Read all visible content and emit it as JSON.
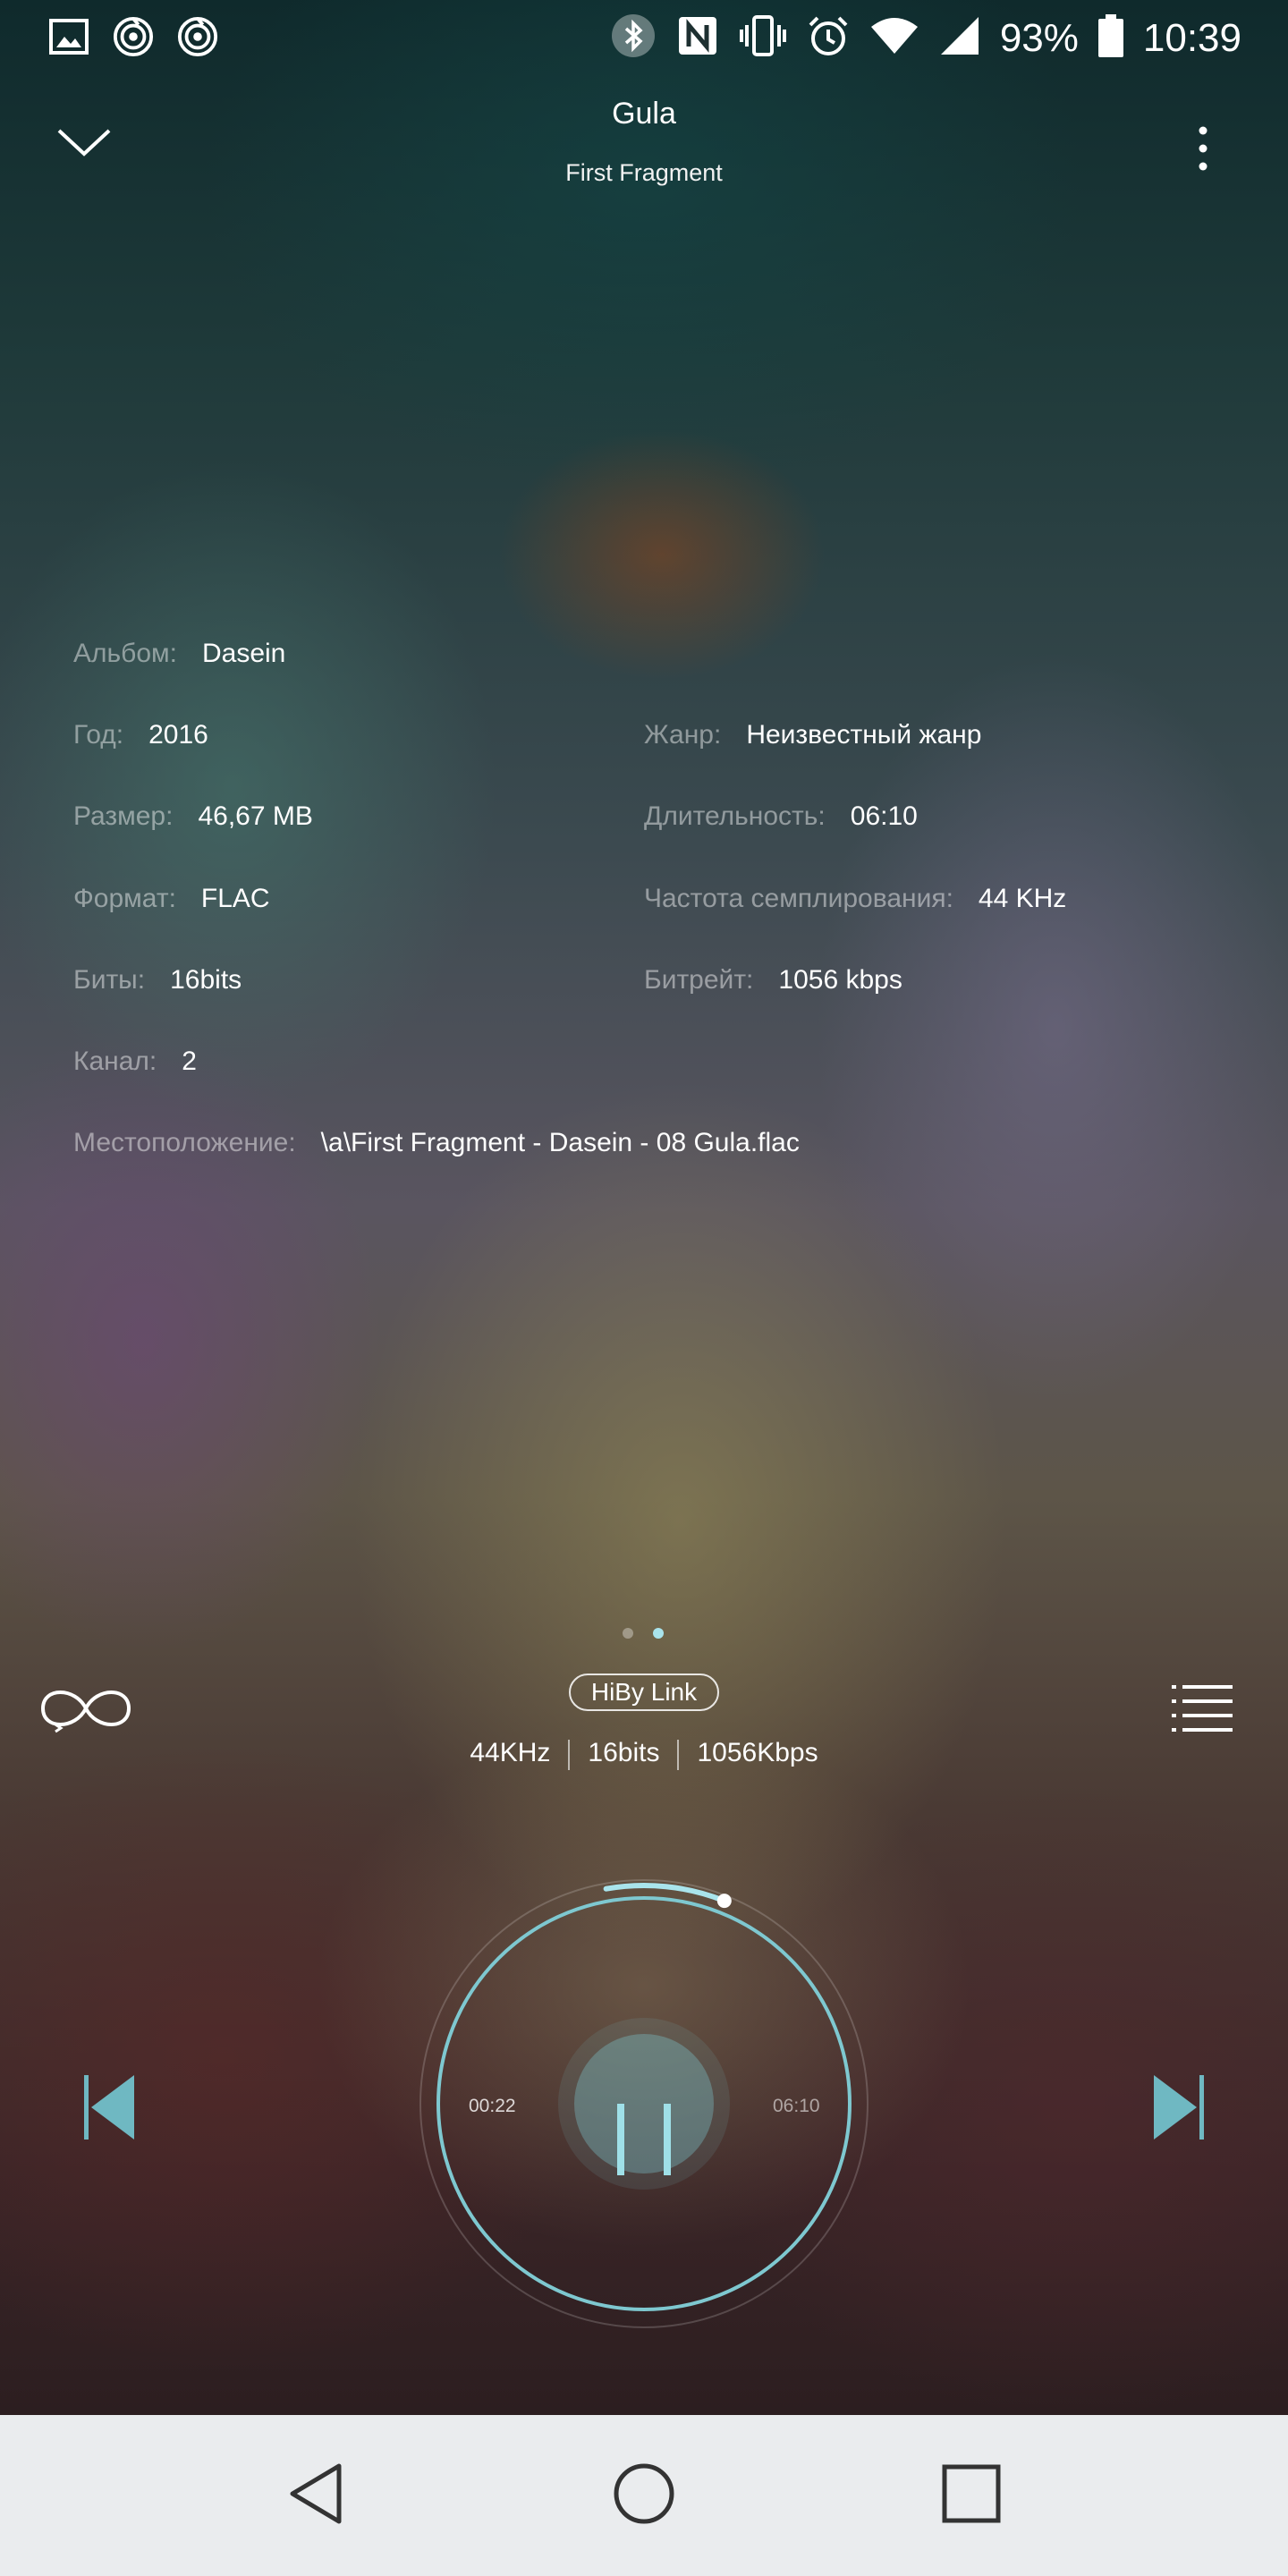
{
  "status_bar": {
    "battery": "93%",
    "time": "10:39"
  },
  "header": {
    "title": "Gula",
    "subtitle": "First Fragment"
  },
  "info": {
    "album": {
      "label": "Альбом:",
      "value": "Dasein"
    },
    "year": {
      "label": "Год:",
      "value": "2016"
    },
    "genre": {
      "label": "Жанр:",
      "value": "Неизвестный жанр"
    },
    "size": {
      "label": "Размер:",
      "value": "46,67 MB"
    },
    "duration": {
      "label": "Длительность:",
      "value": "06:10"
    },
    "format": {
      "label": "Формат:",
      "value": "FLAC"
    },
    "sample_rate": {
      "label": "Частота семплирования:",
      "value": "44 KHz"
    },
    "bits": {
      "label": "Биты:",
      "value": "16bits"
    },
    "bitrate": {
      "label": "Битрейт:",
      "value": "1056 kbps"
    },
    "channel": {
      "label": "Канал:",
      "value": "2"
    },
    "location": {
      "label": "Местоположение:",
      "value": "\\a\\First Fragment - Dasein - 08 Gula.flac"
    }
  },
  "pager": {
    "count": 2,
    "active": 2
  },
  "playback": {
    "hiby_link": "HiBy Link",
    "specs": [
      "44KHz",
      "16bits",
      "1056Kbps"
    ],
    "elapsed": "00:22",
    "total": "06:10",
    "progress_fraction": 0.06,
    "state": "playing"
  },
  "colors": {
    "accent": "#7ec8d0",
    "nav_bar": "#eaecee"
  },
  "icons": [
    "gallery-icon",
    "app-notification-icon",
    "bluetooth-icon",
    "nfc-icon",
    "vibrate-icon",
    "alarm-icon",
    "wifi-icon",
    "signal-icon",
    "battery-icon",
    "chevron-down-icon",
    "more-vert-icon",
    "repeat-icon",
    "playlist-icon",
    "skip-previous-icon",
    "skip-next-icon",
    "pause-icon",
    "nav-back-icon",
    "nav-home-icon",
    "nav-recents-icon"
  ]
}
